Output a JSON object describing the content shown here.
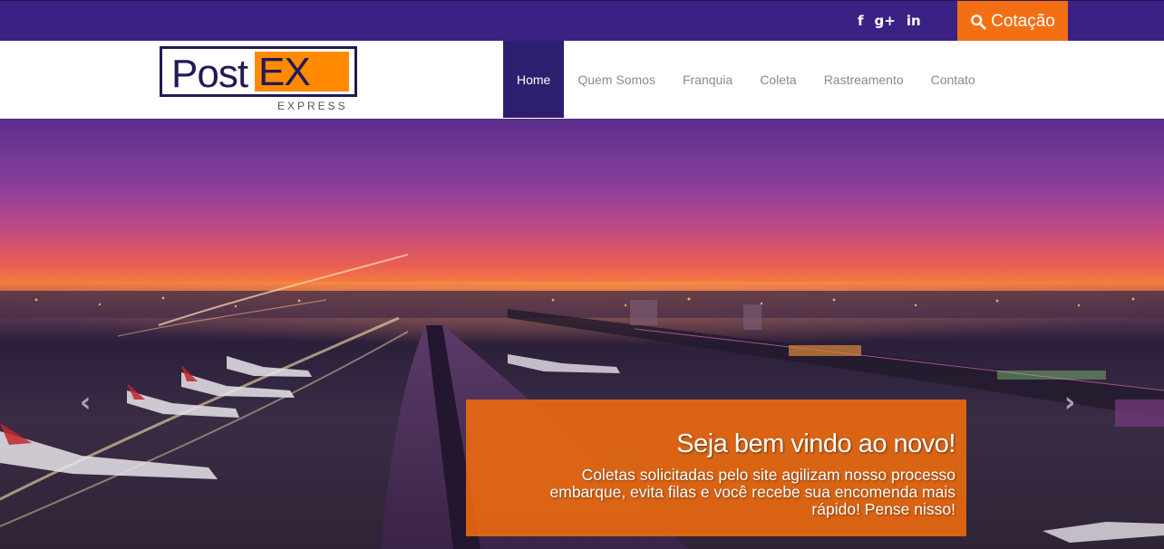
{
  "social": {
    "facebook": "f",
    "googleplus": "g+",
    "linkedin": "in"
  },
  "quote_button": {
    "label": "Cotação",
    "icon": "search-icon"
  },
  "logo": {
    "post": "Post",
    "ex": "EX",
    "express": "EXPRESS"
  },
  "nav": {
    "items": [
      {
        "label": "Home"
      },
      {
        "label": "Quem Somos"
      },
      {
        "label": "Franquia"
      },
      {
        "label": "Coleta"
      },
      {
        "label": "Rastreamento"
      },
      {
        "label": "Contato"
      }
    ]
  },
  "hero": {
    "prev_arrow": "‹",
    "next_arrow": "›",
    "title": "Seja bem vindo ao novo!",
    "text": "Coletas solicitadas pelo site agilizam nosso processo embarque, evita filas e você recebe sua encomenda mais rápido! Pense nisso!"
  },
  "colors": {
    "topbar": "#3a2285",
    "accent": "#f36f14",
    "nav_active": "#2e1f6e"
  }
}
